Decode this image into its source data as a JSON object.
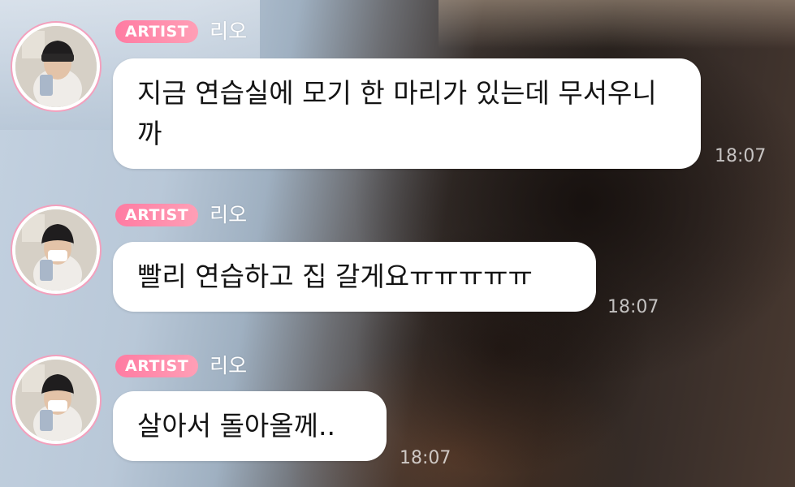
{
  "badge_label": "ARTIST",
  "messages": [
    {
      "sender": "리오",
      "text": "지금 연습실에 모기 한 마리가 있는데 무서우니까",
      "time": "18:07"
    },
    {
      "sender": "리오",
      "text": "빨리 연습하고 집 갈게요ㅠㅠㅠㅠㅠ",
      "time": "18:07"
    },
    {
      "sender": "리오",
      "text": "살아서 돌아올께..",
      "time": "18:07"
    }
  ],
  "colors": {
    "badge": "#ff7ba2",
    "avatar_ring": "#f3a0bd",
    "bubble": "#ffffff"
  }
}
